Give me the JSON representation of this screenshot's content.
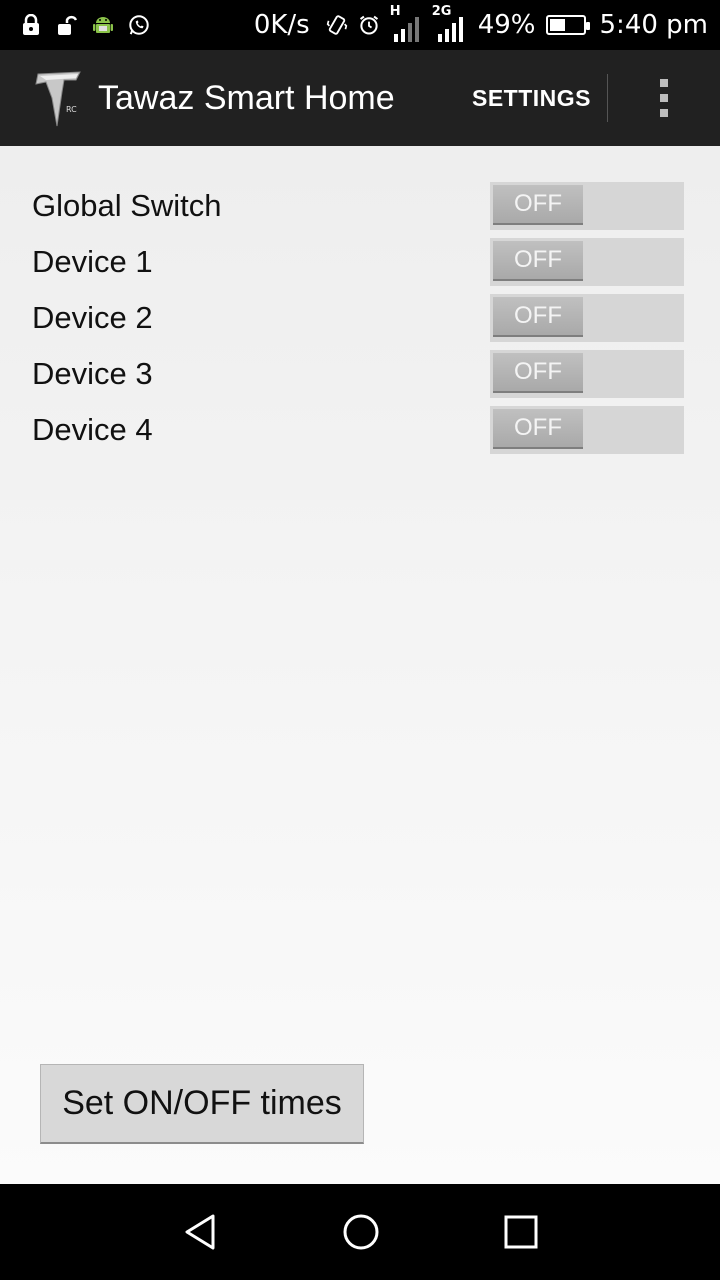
{
  "status_bar": {
    "net_speed": "0K/s",
    "network_h": "H",
    "network_2g": "2G",
    "battery_percent": "49%",
    "battery_level": 0.49,
    "time": "5:40 pm",
    "icons": [
      "lock-icon",
      "unlock-icon",
      "android-icon",
      "whatsapp-icon",
      "vibrate-icon",
      "alarm-icon",
      "signal-icon",
      "signal-icon",
      "battery-icon"
    ]
  },
  "action_bar": {
    "title": "Tawaz Smart Home",
    "settings_label": "SETTINGS",
    "logo_text": "RC"
  },
  "switches": [
    {
      "label": "Global Switch",
      "state": "OFF"
    },
    {
      "label": "Device 1",
      "state": "OFF"
    },
    {
      "label": "Device 2",
      "state": "OFF"
    },
    {
      "label": "Device 3",
      "state": "OFF"
    },
    {
      "label": "Device 4",
      "state": "OFF"
    }
  ],
  "timer_button": {
    "label": "Set ON/OFF times"
  },
  "nav_bar": {
    "icons": [
      "back-icon",
      "home-icon",
      "recents-icon"
    ]
  },
  "colors": {
    "action_bar": "#212121",
    "toggle_track": "#d6d6d6",
    "toggle_thumb": "#b0b0b0"
  }
}
